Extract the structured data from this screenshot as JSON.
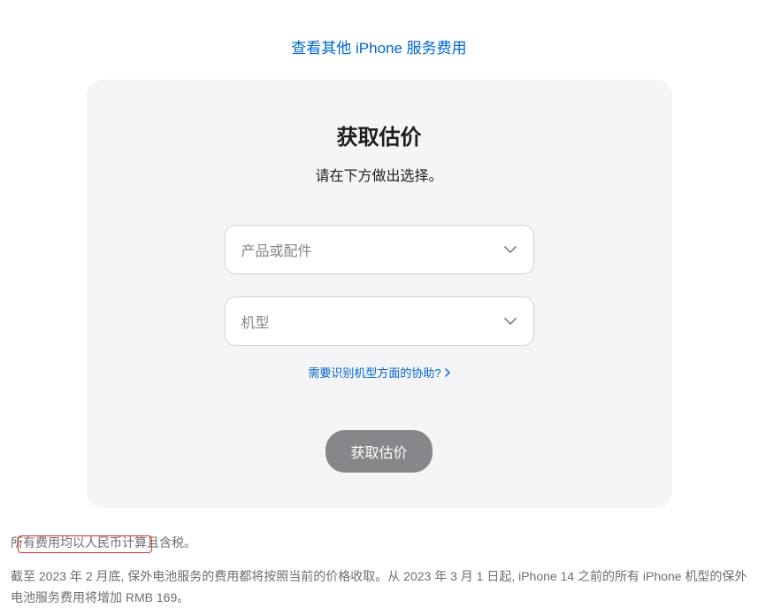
{
  "top_link": {
    "label": "查看其他 iPhone 服务费用"
  },
  "card": {
    "title": "获取估价",
    "subtitle": "请在下方做出选择。",
    "product_select": {
      "placeholder": "产品或配件"
    },
    "model_select": {
      "placeholder": "机型"
    },
    "help_link": {
      "label": "需要识别机型方面的协助?"
    },
    "submit_button": {
      "label": "获取估价"
    }
  },
  "footer": {
    "line1": "所有费用均以人民币计算且含税。",
    "line2": "截至 2023 年 2 月底, 保外电池服务的费用都将按照当前的价格收取。从 2023 年 3 月 1 日起, iPhone 14 之前的所有 iPhone 机型的保外电池服务费用将增加 RMB 169。"
  }
}
